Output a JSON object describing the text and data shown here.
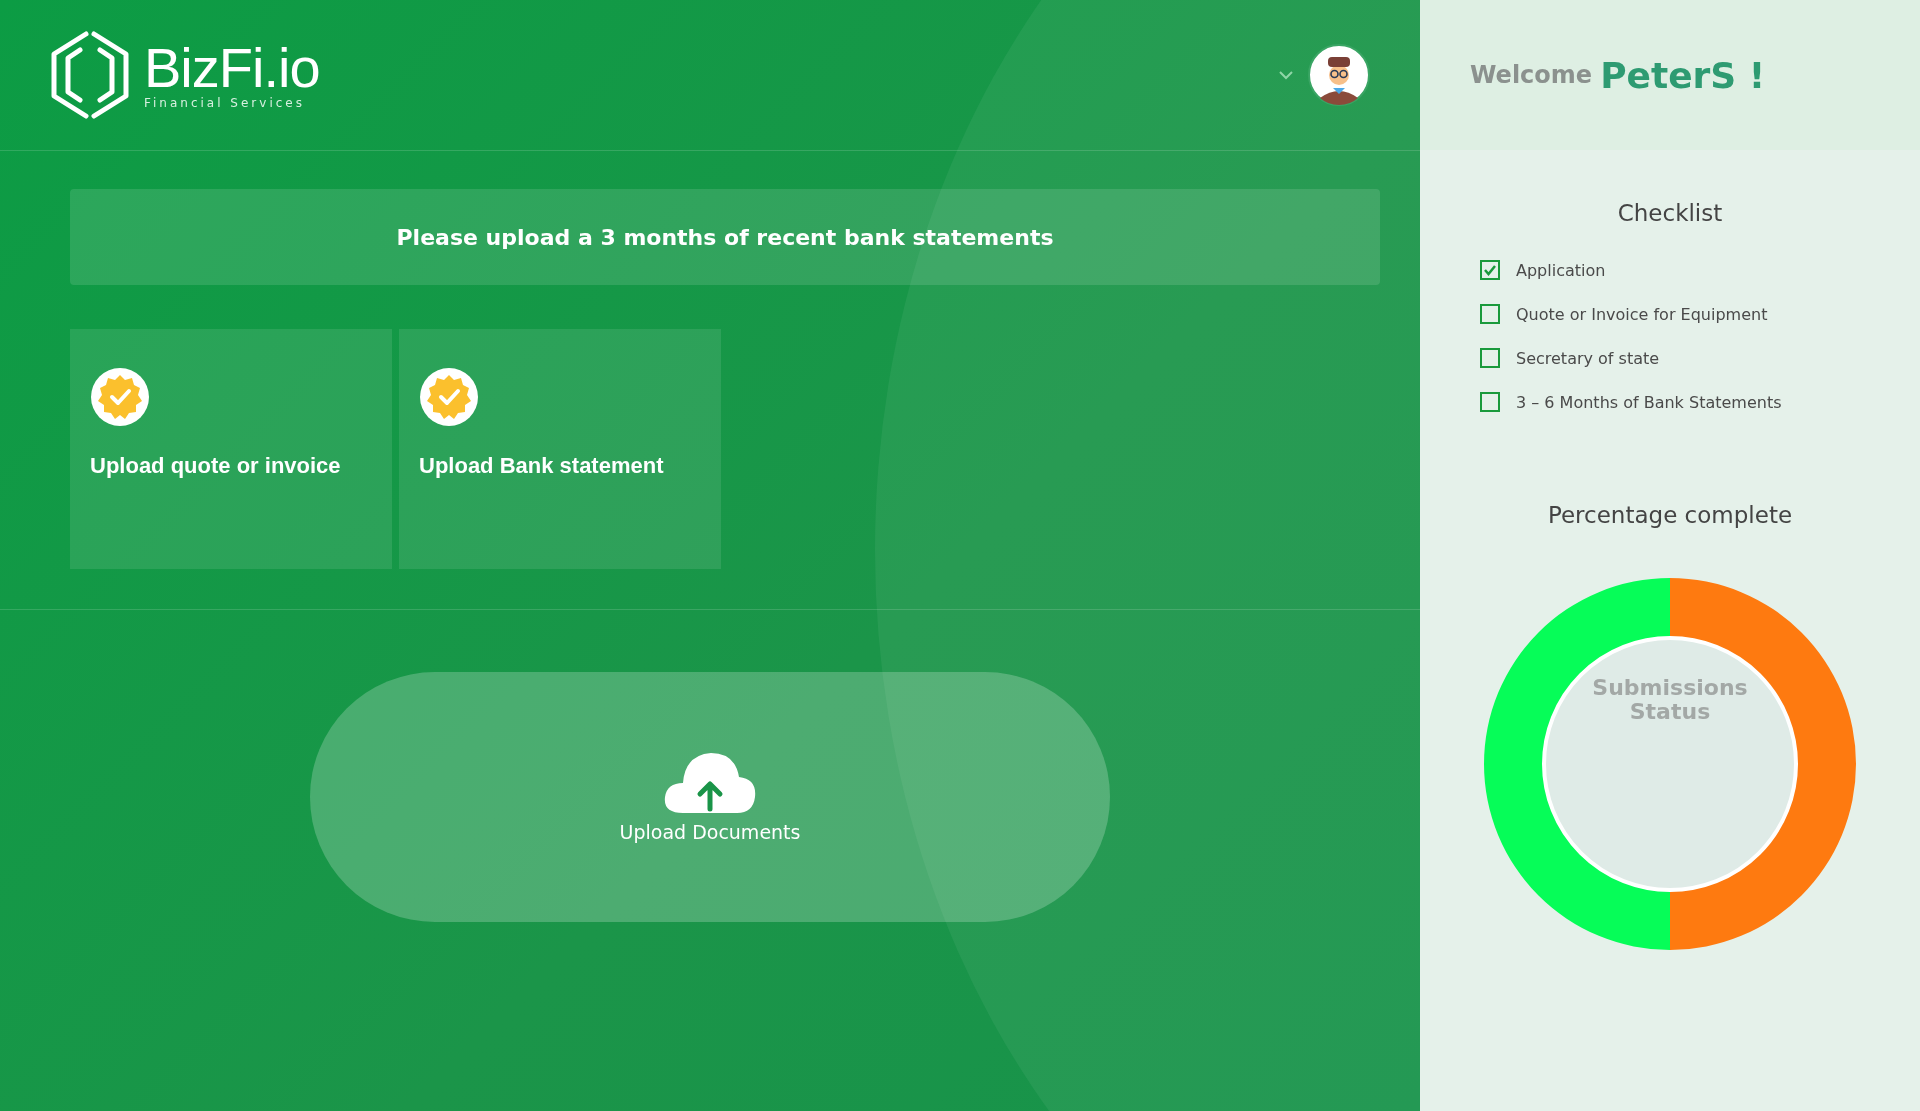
{
  "brand": {
    "name": "BizFi.io",
    "tagline": "Financial Services"
  },
  "welcome": {
    "greeting": "Welcome",
    "user": "PeterS !"
  },
  "banner": "Please upload a 3 months of recent bank statements",
  "upload_cards": [
    {
      "label": "Upload quote or invoice",
      "verified": true
    },
    {
      "label": "Upload Bank statement",
      "verified": true
    }
  ],
  "upload_button": {
    "label": "Upload Documents"
  },
  "checklist": {
    "title": "Checklist",
    "items": [
      {
        "label": "Application",
        "checked": true
      },
      {
        "label": "Quote or Invoice for Equipment",
        "checked": false
      },
      {
        "label": "Secretary of state",
        "checked": false
      },
      {
        "label": "3 – 6 Months of Bank Statements",
        "checked": false
      }
    ]
  },
  "progress": {
    "title": "Percentage complete",
    "center_label": "Submissions Status"
  }
}
